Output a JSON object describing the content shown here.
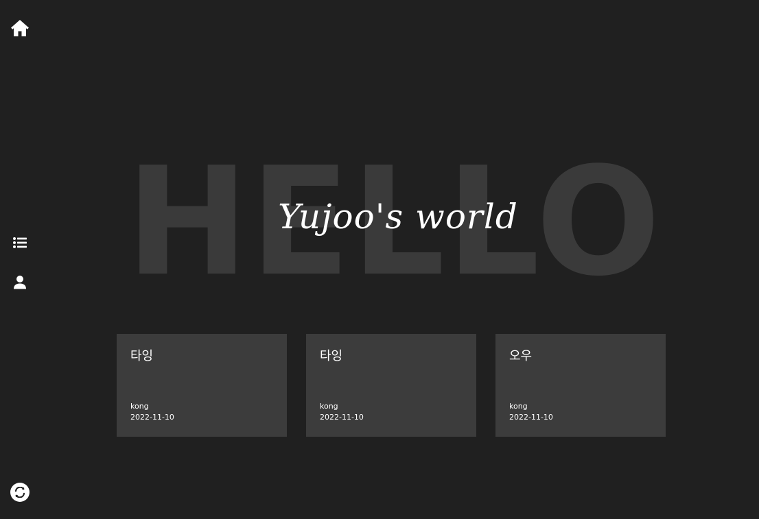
{
  "nav": {
    "home_icon": "home-icon",
    "list_icon": "list-icon",
    "user_icon": "user-icon",
    "refresh_icon": "refresh-icon"
  },
  "hero": {
    "background_text": "HELLO",
    "title": "Yujoo's world"
  },
  "posts": [
    {
      "title": "타잉",
      "author": "kong",
      "date": "2022-11-10"
    },
    {
      "title": "타잉",
      "author": "kong",
      "date": "2022-11-10"
    },
    {
      "title": "오우",
      "author": "kong",
      "date": "2022-11-10"
    }
  ],
  "colors": {
    "background": "#202020",
    "card": "#3c3c3c",
    "hello_text": "#3a3a3a",
    "foreground": "#ffffff"
  }
}
